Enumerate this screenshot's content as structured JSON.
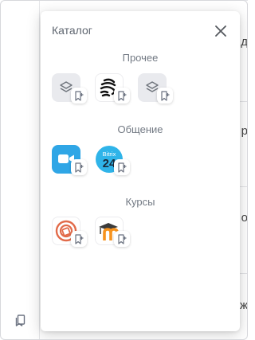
{
  "catalog": {
    "title": "Каталог",
    "sections": [
      {
        "title": "Прочее",
        "apps": [
          "layers-icon",
          "slack-like-logo-icon",
          "layers-icon"
        ]
      },
      {
        "title": "Общение",
        "apps": [
          "video-call-icon",
          "bitrix24-logo-icon"
        ]
      },
      {
        "title": "Курсы",
        "apps": [
          "course-logo-icon",
          "moodle-logo-icon"
        ]
      }
    ],
    "bitrix_logo_text": "Bitrix",
    "bitrix_logo_number": "24"
  },
  "background_glyphs": [
    "д",
    "р",
    "о",
    "ж"
  ],
  "colors": {
    "accent_blue": "#2fa6e6",
    "moodle_orange": "#f7931e",
    "tile_gray": "#e9eaee"
  }
}
